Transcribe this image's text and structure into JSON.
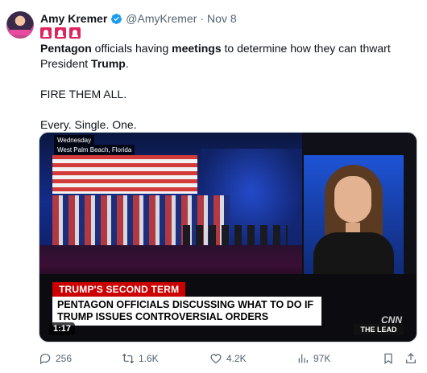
{
  "tweet": {
    "author": {
      "name": "Amy Kremer",
      "handle": "@AmyKremer",
      "separator": "·",
      "date": "Nov 8"
    },
    "emoji": [
      "siren-icon",
      "siren-icon",
      "siren-icon"
    ],
    "text": {
      "line1_part1": "Pentagon",
      "line1_part2": " officials having ",
      "line1_part3": "meetings",
      "line1_part4": " to determine how they can thwart President ",
      "line1_part5": "Trump",
      "line1_part6": ".",
      "line2": "FIRE THEM ALL.",
      "line3": "Every. Single. One."
    },
    "media": {
      "location_day": "Wednesday",
      "location_city": "West Palm Beach, Florida",
      "segment": "TRUMP'S SECOND TERM",
      "headline": "PENTAGON OFFICIALS DISCUSSING WHAT TO DO IF TRUMP ISSUES CONTROVERSIAL ORDERS",
      "network": "CNN",
      "show": "THE LEAD",
      "duration": "1:17"
    },
    "actions": {
      "replies": "256",
      "reposts": "1.6K",
      "likes": "4.2K",
      "views": "97K"
    }
  },
  "colors": {
    "verified": "#1d9bf0",
    "muted": "#536471",
    "cnn_red": "#cc0000"
  }
}
